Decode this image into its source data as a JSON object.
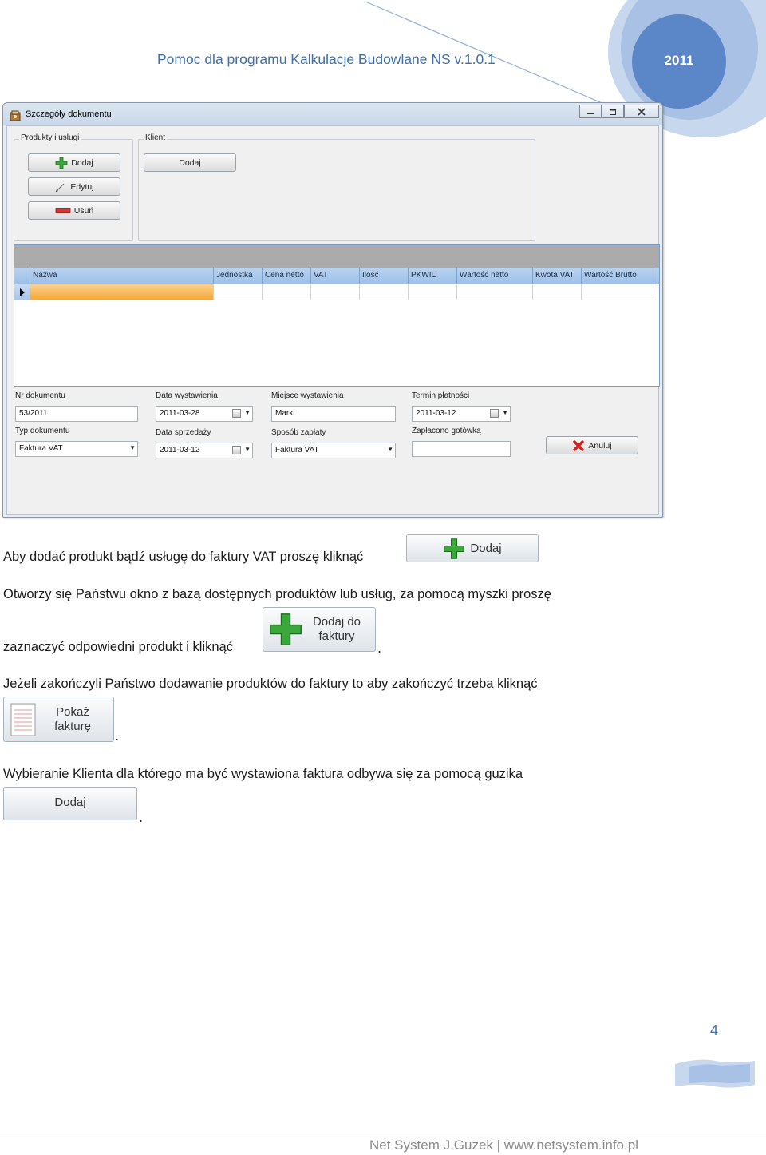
{
  "header": {
    "title": "Pomoc dla programu Kalkulacje Budowlane NS v.1.0.1",
    "year": "2011"
  },
  "window": {
    "title": "Szczegóły dokumentu",
    "controls": {
      "minimize": "minimize-icon",
      "maximize": "maximize-icon",
      "close": "close-icon"
    },
    "products_group": {
      "label": "Produkty i usługi",
      "add": "Dodaj",
      "edit": "Edytuj",
      "remove": "Usuń"
    },
    "client_group": {
      "label": "Klient",
      "add": "Dodaj"
    },
    "grid": {
      "columns": [
        "Nazwa",
        "Jednostka",
        "Cena netto",
        "VAT",
        "Ilość",
        "PKWIU",
        "Wartość netto",
        "Kwota VAT",
        "Wartość Brutto"
      ]
    },
    "fields": {
      "doc_number_label": "Nr dokumentu",
      "doc_number": "53/2011",
      "issue_date_label": "Data wystawienia",
      "issue_date": "2011-03-28",
      "issue_place_label": "Miejsce wystawienia",
      "issue_place": "Marki",
      "payment_due_label": "Termin płatności",
      "payment_due": "2011-03-12",
      "doc_type_label": "Typ dokumentu",
      "doc_type": "Faktura VAT",
      "sale_date_label": "Data sprzedaży",
      "sale_date": "2011-03-12",
      "payment_method_label": "Sposób zapłaty",
      "payment_method": "Faktura VAT",
      "cash_paid_label": "Zapłacono gotówką",
      "cash_paid": ""
    },
    "cancel": "Anuluj"
  },
  "body": {
    "p1": "Aby dodać produkt bądź usługę do faktury VAT proszę kliknąć",
    "btn_add": "Dodaj",
    "p2": "Otworzy się Państwu okno z bazą dostępnych produktów lub usług, za pomocą myszki proszę",
    "p3": "zaznaczyć odpowiedni produkt i kliknąć",
    "btn_add_to_invoice": "Dodaj do faktury",
    "dot1": ".",
    "p4": "Jeżeli zakończyli Państwo dodawanie produktów do faktury to aby zakończyć trzeba kliknąć",
    "btn_show_invoice": "Pokaż fakturę",
    "dot2": ".",
    "p5": "Wybieranie Klienta dla którego ma być wystawiona faktura odbywa się za pomocą guzika",
    "btn_add_client": "Dodaj",
    "dot3": "."
  },
  "footer": {
    "page_number": "4",
    "text": "Net System J.Guzek | www.netsystem.info.pl"
  }
}
